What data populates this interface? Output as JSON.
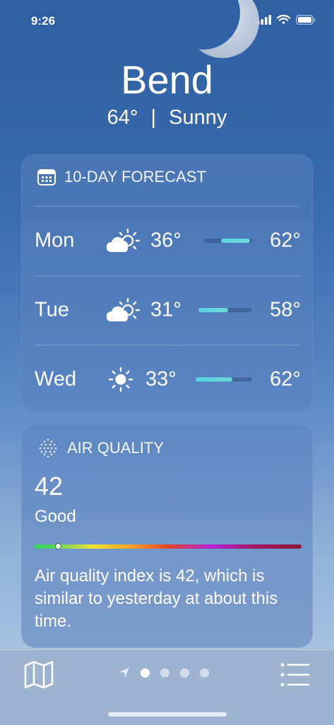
{
  "status_bar": {
    "time": "9:26"
  },
  "header": {
    "city": "Bend",
    "temp": "64°",
    "separator": "|",
    "condition": "Sunny"
  },
  "forecast": {
    "title": "10-DAY FORECAST",
    "days": [
      {
        "day": "Mon",
        "icon": "partly-cloudy-icon",
        "low": "36°",
        "high": "62°",
        "range_start": 0.35,
        "range_end": 0.95
      },
      {
        "day": "Tue",
        "icon": "partly-cloudy-icon",
        "low": "31°",
        "high": "58°",
        "range_start": 0.0,
        "range_end": 0.55
      },
      {
        "day": "Wed",
        "icon": "sun-icon",
        "low": "33°",
        "high": "62°",
        "range_start": 0.0,
        "range_end": 0.65
      }
    ]
  },
  "air_quality": {
    "title": "AIR QUALITY",
    "value": "42",
    "label": "Good",
    "scale_position": 0.09,
    "description": "Air quality index is 42, which is similar to yesterday at about this time."
  },
  "colors": {
    "bar_fill": "#58d3e2",
    "card_bg": "#5a82be"
  },
  "bottom_bar": {
    "page_count": 4,
    "active_page": 0
  }
}
